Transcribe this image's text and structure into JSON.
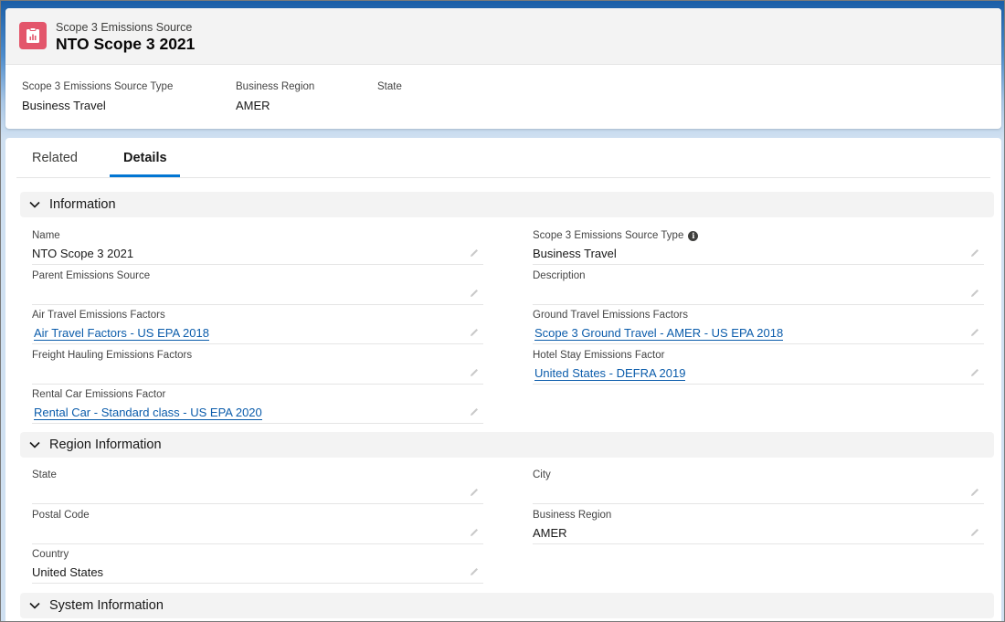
{
  "header": {
    "object_type": "Scope 3 Emissions Source",
    "record_name": "NTO Scope 3 2021",
    "icon": "emissions-chart-icon",
    "icon_color": "#e3566b",
    "highlights": [
      {
        "label": "Scope 3 Emissions Source Type",
        "value": "Business Travel"
      },
      {
        "label": "Business Region",
        "value": "AMER"
      },
      {
        "label": "State",
        "value": ""
      }
    ]
  },
  "tabs": [
    {
      "label": "Related",
      "active": false
    },
    {
      "label": "Details",
      "active": true
    }
  ],
  "sections": {
    "information": {
      "title": "Information",
      "fields": {
        "name": {
          "label": "Name",
          "value": "NTO Scope 3 2021"
        },
        "source_type": {
          "label": "Scope 3 Emissions Source Type",
          "value": "Business Travel"
        },
        "parent": {
          "label": "Parent Emissions Source",
          "value": ""
        },
        "description": {
          "label": "Description",
          "value": ""
        },
        "air_travel": {
          "label": "Air Travel Emissions Factors",
          "value": "Air Travel Factors - US EPA 2018"
        },
        "ground_travel": {
          "label": "Ground Travel Emissions Factors",
          "value": "Scope 3 Ground Travel - AMER - US EPA 2018"
        },
        "freight": {
          "label": "Freight Hauling Emissions Factors",
          "value": ""
        },
        "hotel": {
          "label": "Hotel Stay Emissions Factor",
          "value": "United States - DEFRA 2019"
        },
        "rental_car": {
          "label": "Rental Car Emissions Factor",
          "value": "Rental Car - Standard class - US EPA 2020"
        }
      }
    },
    "region": {
      "title": "Region Information",
      "fields": {
        "state": {
          "label": "State",
          "value": ""
        },
        "city": {
          "label": "City",
          "value": ""
        },
        "postal_code": {
          "label": "Postal Code",
          "value": ""
        },
        "business_region": {
          "label": "Business Region",
          "value": "AMER"
        },
        "country": {
          "label": "Country",
          "value": "United States"
        }
      }
    },
    "system": {
      "title": "System Information"
    }
  },
  "colors": {
    "link": "#0b5cab",
    "tab_active": "#0176d3",
    "background": "#1b5fa8"
  }
}
